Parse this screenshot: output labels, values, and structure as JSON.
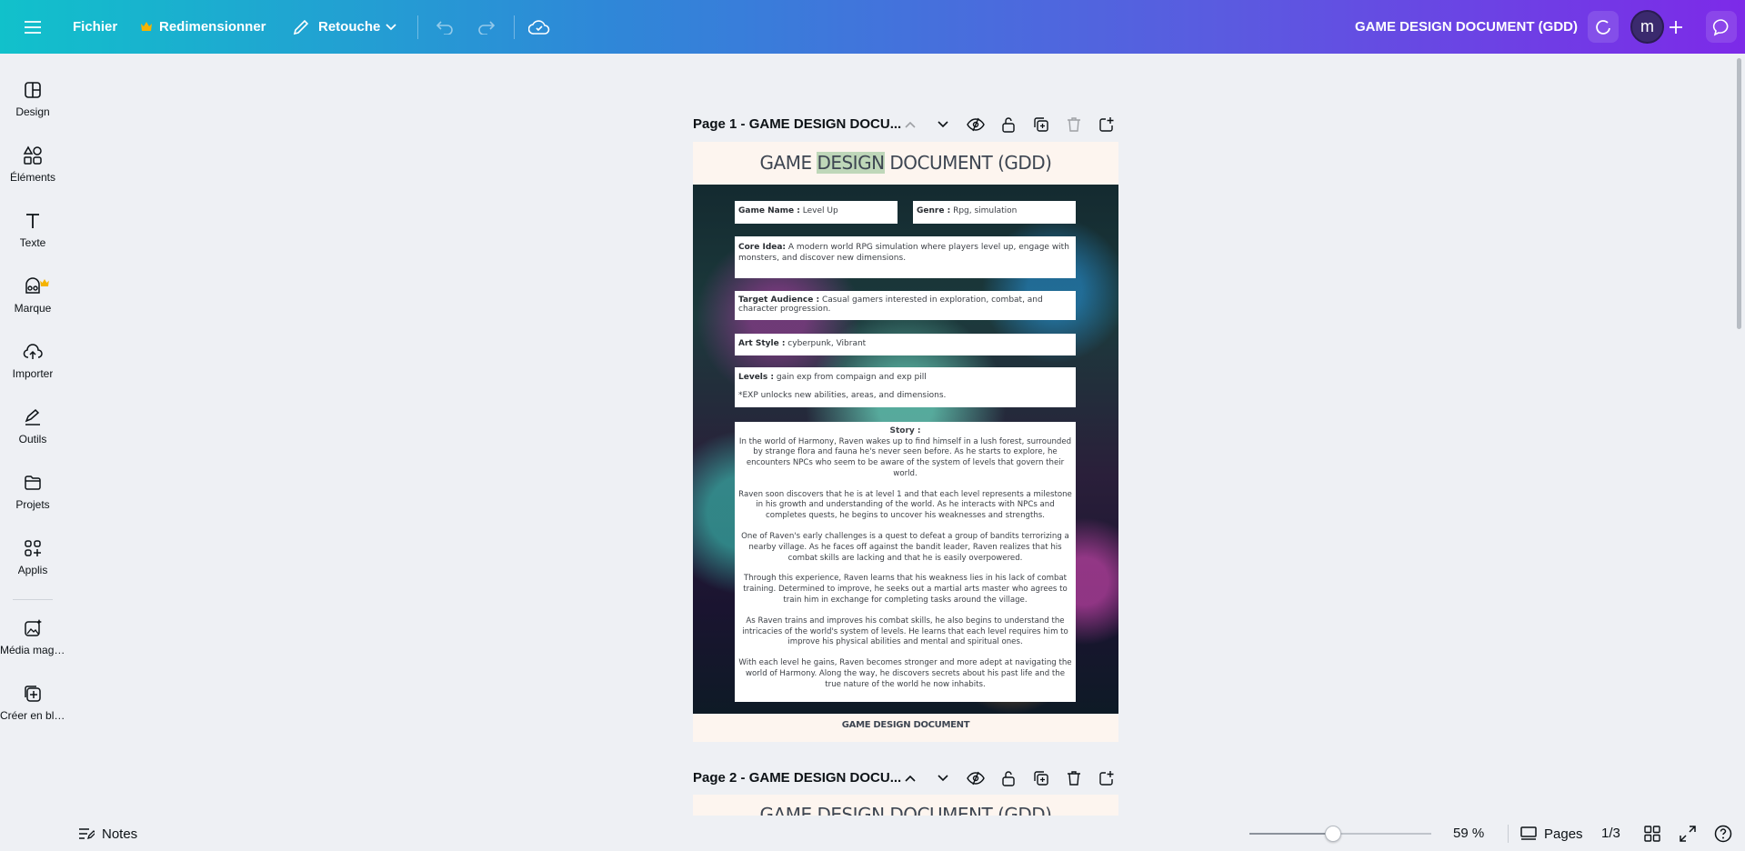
{
  "topbar": {
    "file_label": "Fichier",
    "resize_label": "Redimensionner",
    "retouch_label": "Retouche",
    "doc_title": "GAME DESIGN DOCUMENT (GDD)",
    "avatar_letter": "m",
    "colors": {
      "gradient_start": "#11c1cb",
      "gradient_end": "#7d2ae8",
      "crown": "#f5b300"
    }
  },
  "sidebar": {
    "items": [
      {
        "label": "Design",
        "icon": "layout-icon"
      },
      {
        "label": "Éléments",
        "icon": "shapes-icon"
      },
      {
        "label": "Texte",
        "icon": "text-icon"
      },
      {
        "label": "Marque",
        "icon": "brand-icon"
      },
      {
        "label": "Importer",
        "icon": "upload-cloud-icon"
      },
      {
        "label": "Outils",
        "icon": "pen-icon"
      },
      {
        "label": "Projets",
        "icon": "folder-icon"
      },
      {
        "label": "Applis",
        "icon": "apps-icon"
      },
      {
        "label": "Média magi...",
        "icon": "magic-media-icon"
      },
      {
        "label": "Créer en bloc",
        "icon": "bulk-create-icon"
      }
    ]
  },
  "pages": [
    {
      "title": "Page 1 - GAME DESIGN DOCU..."
    },
    {
      "title": "Page 2 - GAME DESIGN DOCU..."
    }
  ],
  "document": {
    "heading_pre": "GAME ",
    "heading_hl": "DESIGN",
    "heading_post": " DOCUMENT (GDD)",
    "game_name_label": "Game Name :",
    "game_name": "Level Up",
    "genre_label": "Genre :",
    "genre": "Rpg, simulation",
    "core_idea_label": "Core Idea:",
    "core_idea": "A modern world RPG simulation where players level up, engage with monsters, and discover new dimensions.",
    "audience_label": "Target Audience :",
    "audience": "Casual gamers interested in exploration, combat, and character progression.",
    "art_style_label": "Art Style :",
    "art_style": "cyberpunk, Vibrant",
    "levels_label": "Levels :",
    "levels": "gain exp from compaign and exp pill",
    "levels_note": "*EXP unlocks new abilities, areas, and dimensions.",
    "story_title": "Story :",
    "story": [
      "In the world of Harmony, Raven wakes up to find himself in a lush forest, surrounded by strange flora and fauna he's never seen before. As he starts to explore, he encounters NPCs who seem to be aware of the system of levels that govern their world.",
      "Raven soon discovers that he is at level 1 and that each level represents a milestone in his growth and understanding of the world. As he interacts with NPCs and completes quests, he begins to uncover his weaknesses and strengths.",
      "One of Raven's early challenges is a quest to defeat a group of bandits terrorizing a nearby village. As he faces off against the bandit leader, Raven realizes that his combat skills are lacking and that he is easily overpowered.",
      "Through this experience, Raven learns that his weakness lies in his lack of combat training. Determined to improve, he seeks out a martial arts master who agrees to train him in exchange for completing tasks around the village.",
      "As Raven trains and improves his combat skills, he also begins to understand the intricacies of the world's system of levels. He learns that each level requires him to improve his physical abilities and mental and spiritual ones.",
      "With each level he gains, Raven becomes stronger and more adept at navigating the world of Harmony. Along the way, he discovers secrets about his past life and the true nature of the world he now inhabits."
    ],
    "footer": "GAME DESIGN DOCUMENT",
    "page2_heading": "GAME DESIGN DOCUMENT (GDD)"
  },
  "bottombar": {
    "notes_label": "Notes",
    "zoom_value": "59 %",
    "zoom_fraction": 0.46,
    "pages_label": "Pages",
    "page_counter": "1/3"
  }
}
